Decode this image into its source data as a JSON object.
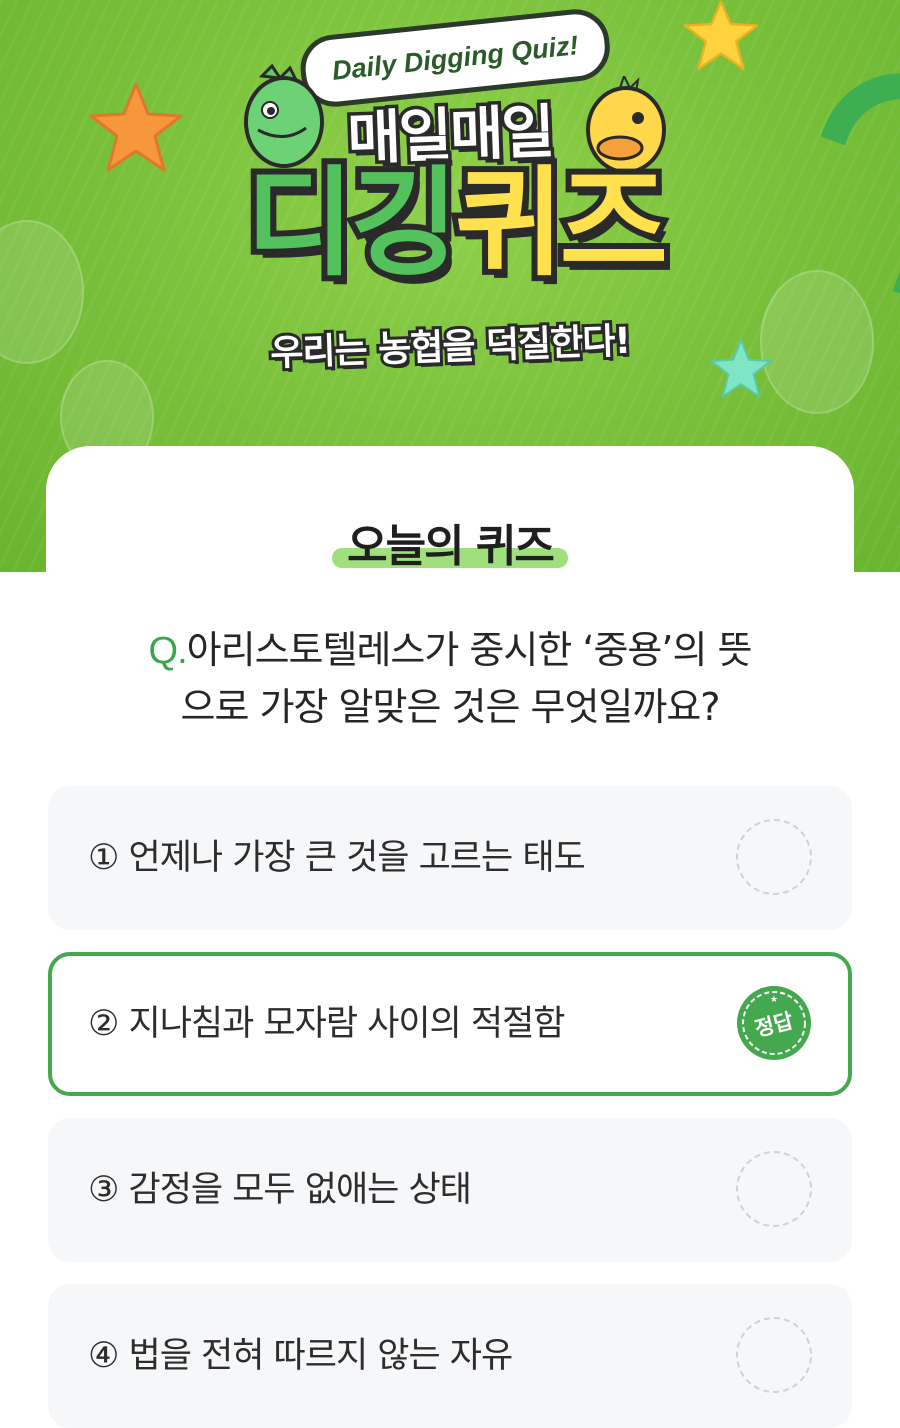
{
  "banner": {
    "sign_text": "Daily Digging Quiz!",
    "title_line1": "매일매일",
    "title_line2_green": "디깅",
    "title_line2_yellow": "퀴즈",
    "slogan": "우리는 농협을 덕질한다!"
  },
  "section": {
    "title": "오늘의 퀴즈"
  },
  "question": {
    "prefix": "Q.",
    "line1": "아리스토텔레스가 중시한 ‘중용’의 뜻",
    "line2": "으로 가장 알맞은 것은 무엇일까요?"
  },
  "options": [
    {
      "label": "① 언제나 가장 큰 것을 고르는 태도",
      "selected": false
    },
    {
      "label": "② 지나침과 모자람 사이의 적절함",
      "selected": true,
      "stamp": "정답"
    },
    {
      "label": "③ 감정을 모두 없애는 상태",
      "selected": false
    },
    {
      "label": "④ 법을 전혀 따르지 않는 자유",
      "selected": false
    }
  ],
  "colors": {
    "accent": "#44a84e",
    "banner_green": "#7cc23c",
    "option_bg": "#f6f7f9",
    "highlight": "#9fe07c"
  }
}
